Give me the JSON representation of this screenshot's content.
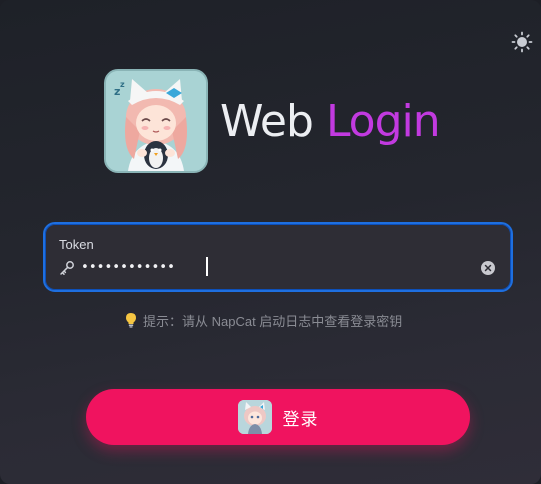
{
  "header": {
    "title_part1": "Web",
    "title_part2": "Login",
    "title_colors": {
      "part1": "#eceef2",
      "part2": "#c23ae0"
    },
    "logo_icon": "napcat-mascot-logo"
  },
  "theme_toggle": {
    "icon": "sun-icon"
  },
  "token_field": {
    "label": "Token",
    "value": "••••••••••••",
    "type": "password",
    "prefix_icon": "key-icon",
    "suffix_icon": "clear-icon",
    "focus_color": "#1e6fe0"
  },
  "hint": {
    "icon": "lightbulb-icon",
    "text": "提示：请从 NapCat 启动日志中查看登录密钥"
  },
  "login_button": {
    "label": "登录",
    "icon": "napcat-mascot-avatar",
    "color": "#f0135f"
  }
}
